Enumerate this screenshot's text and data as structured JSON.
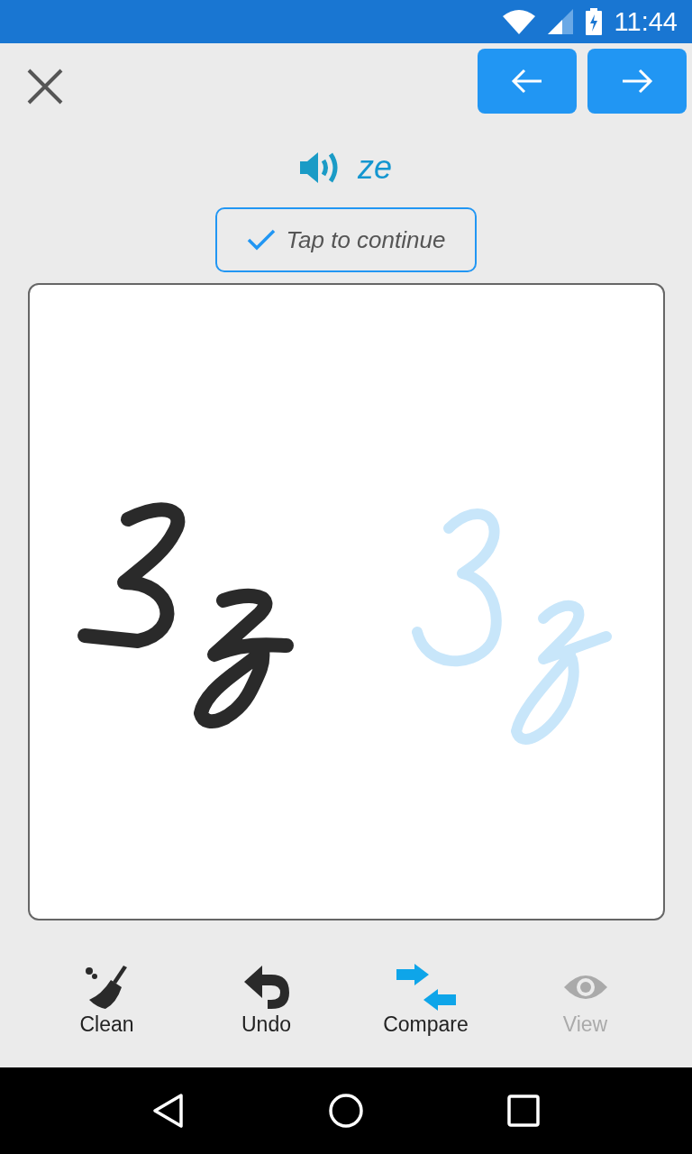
{
  "status_bar": {
    "time": "11:44"
  },
  "word": {
    "text": "ze"
  },
  "continue_button": {
    "label": "Tap to continue"
  },
  "tools": [
    {
      "label": "Clean",
      "kind": "clean",
      "active": false,
      "disabled": false
    },
    {
      "label": "Undo",
      "kind": "undo",
      "active": false,
      "disabled": false
    },
    {
      "label": "Compare",
      "kind": "compare",
      "active": true,
      "disabled": false
    },
    {
      "label": "View",
      "kind": "view",
      "active": false,
      "disabled": true
    }
  ]
}
